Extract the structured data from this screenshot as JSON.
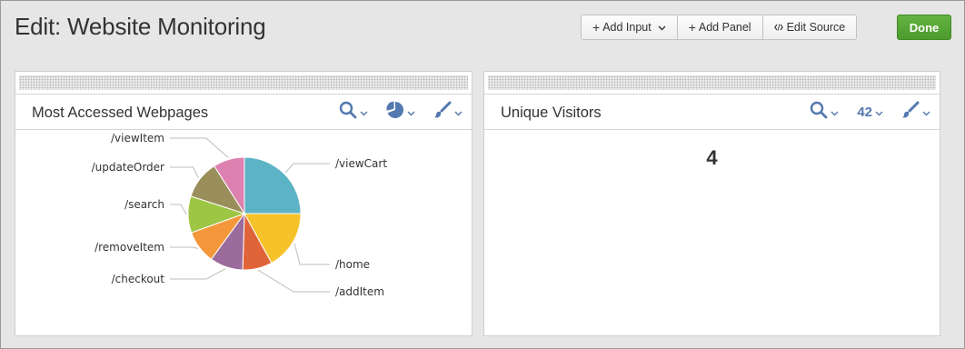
{
  "header": {
    "title": "Edit: Website Monitoring",
    "toolbar": {
      "add_input": "Add Input",
      "add_panel": "Add Panel",
      "edit_source": "Edit Source"
    },
    "done_label": "Done"
  },
  "panels": [
    {
      "title": "Most Accessed Webpages",
      "visualization": "pie"
    },
    {
      "title": "Unique Visitors",
      "visualization": "single-value",
      "viz_icon_label": "42",
      "value": "4"
    }
  ],
  "colors": {
    "accent": "#5379af",
    "done": "#5aa938"
  },
  "chart_data": {
    "type": "pie",
    "title": "Most Accessed Webpages",
    "categories": [
      "/viewCart",
      "/home",
      "/addItem",
      "/checkout",
      "/removeItem",
      "/search",
      "/updateOrder",
      "/viewItem"
    ],
    "values": [
      25,
      17,
      8.5,
      9.5,
      9.5,
      10.5,
      11,
      9
    ],
    "colors": [
      "#5bb3c5",
      "#f5c22a",
      "#e0643a",
      "#9b6b9c",
      "#f4973a",
      "#9cc644",
      "#9a8e5a",
      "#dd82b0"
    ],
    "legend": "none",
    "label_placement": "callout"
  }
}
